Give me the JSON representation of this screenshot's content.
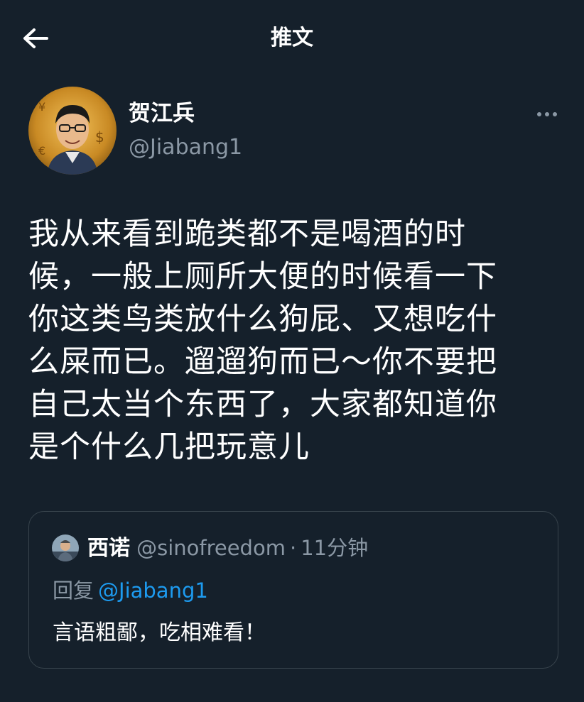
{
  "header": {
    "title": "推文",
    "back_icon": "arrow-left-icon"
  },
  "tweet": {
    "author_name": "贺江兵",
    "author_handle": "@Jiabang1",
    "more_icon": "more-horizontal-icon",
    "lines": [
      "我从来看到跪类都不是喝酒的时",
      "候，一般上厕所大便的时候看一下",
      "你这类鸟类放什么狗屁、又想吃什",
      "么屎而已。遛遛狗而已～你不要把",
      "自己太当个东西了，大家都知道你",
      "是个什么几把玩意儿"
    ]
  },
  "quoted_tweet": {
    "author_name": "西诺",
    "author_handle": "@sinofreedom",
    "separator": "·",
    "time": "11分钟",
    "reply_prefix": "回复",
    "reply_mention": "@Jiabang1",
    "text": "言语粗鄙，吃相难看！"
  },
  "colors": {
    "background": "#15202b",
    "text_primary": "#ffffff",
    "text_secondary": "#8b98a5",
    "link": "#1d9bf0",
    "border": "#38444d"
  }
}
